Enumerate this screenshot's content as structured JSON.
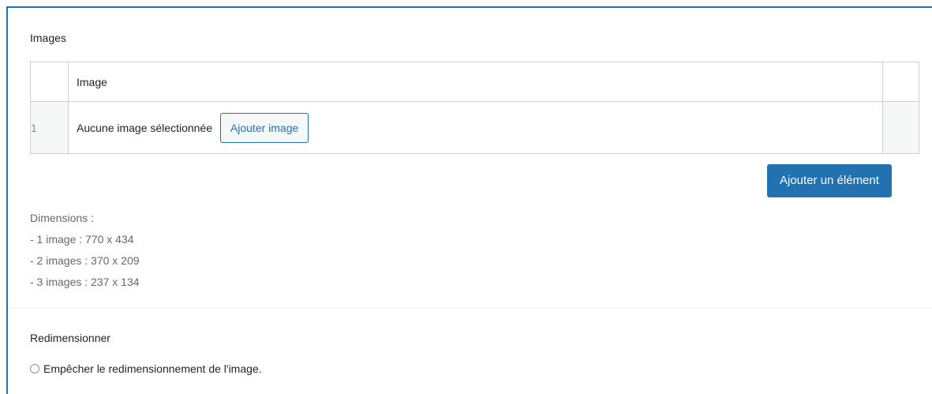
{
  "images_field": {
    "label": "Images",
    "table": {
      "header": "Image",
      "rows": [
        {
          "index": "1",
          "empty_text": "Aucune image sélectionnée",
          "add_image_label": "Ajouter image"
        }
      ]
    },
    "add_element_label": "Ajouter un élément",
    "instructions": {
      "title": "Dimensions :",
      "lines": [
        "- 1 image : 770 x 434",
        "- 2 images : 370 x 209",
        "- 3 images : 237 x 134"
      ]
    }
  },
  "resize_field": {
    "label": "Redimensionner",
    "checkbox_label": "Empêcher le redimensionnement de l'image.",
    "checked": false
  },
  "colors": {
    "accent": "#2271b1",
    "border": "#cccfd4",
    "muted_text": "#646970"
  }
}
